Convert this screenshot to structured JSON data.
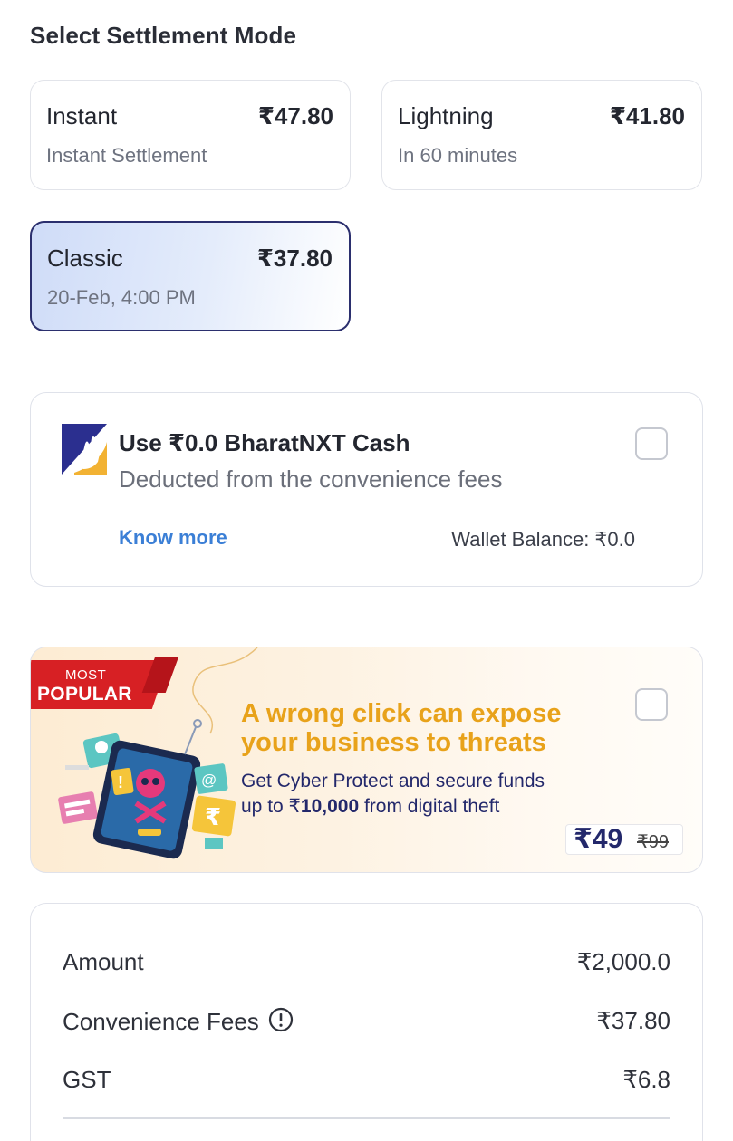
{
  "settlement": {
    "title": "Select Settlement Mode",
    "modes": [
      {
        "name": "Instant",
        "price": "₹47.80",
        "subtitle": "Instant Settlement",
        "selected": false
      },
      {
        "name": "Lightning",
        "price": "₹41.80",
        "subtitle": "In 60 minutes",
        "selected": false
      },
      {
        "name": "Classic",
        "price": "₹37.80",
        "subtitle": "20-Feb, 4:00 PM",
        "selected": true
      }
    ]
  },
  "cash": {
    "title": "Use ₹0.0 BharatNXT Cash",
    "subtitle": "Deducted from the convenience fees",
    "know_more": "Know more",
    "wallet_balance": "Wallet Balance: ₹0.0",
    "checked": false,
    "logo_icon": "bharatnxt-logo"
  },
  "promo": {
    "ribbon_top": "MOST",
    "ribbon_bottom": "POPULAR",
    "headline_line1": "A wrong click can expose",
    "headline_line2": "your business to threats",
    "body_line1": "Get Cyber Protect and secure funds",
    "body_prefix": "up to ₹",
    "body_amount": "10,000",
    "body_suffix": " from digital theft",
    "price_new": "₹49",
    "price_old": "₹99",
    "checked": false,
    "illustration_icon": "cyber-threat-phone-illustration"
  },
  "summary": {
    "rows": [
      {
        "label": "Amount",
        "value": "₹2,000.0"
      },
      {
        "label": "Convenience Fees",
        "value": "₹37.80"
      },
      {
        "label": "GST",
        "value": "₹6.8"
      }
    ],
    "info_icon": "info-icon"
  },
  "colors": {
    "selected_border": "#2b2f6e",
    "link": "#3b7fd6",
    "promo_headline": "#e8a21a",
    "promo_body": "#23286b",
    "ribbon": "#d72024"
  }
}
